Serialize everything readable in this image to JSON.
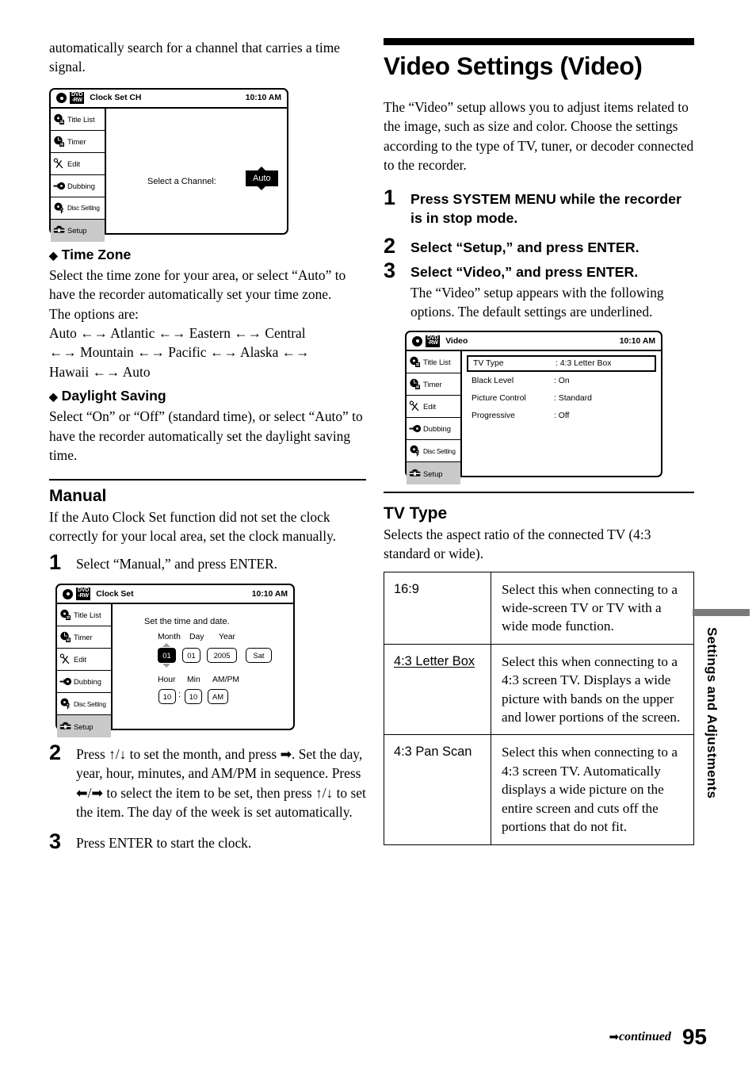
{
  "page_number": "95",
  "footer": {
    "continued": "continued",
    "arrow_icon": "right-arrow-icon"
  },
  "side_tab": {
    "label": "Settings and Adjustments"
  },
  "left_column": {
    "intro_continued": "automatically search for a channel that carries a time signal.",
    "screen_clock_set_ch": {
      "title": "Clock Set CH",
      "clock": "10:10 AM",
      "disc_label_top": "DVD",
      "disc_label_bottom": "-RW",
      "menu": [
        {
          "label": "Title List",
          "icon": "disc-list-icon",
          "selected": false
        },
        {
          "label": "Timer",
          "icon": "clock-timer-icon",
          "selected": false
        },
        {
          "label": "Edit",
          "icon": "scissors-icon",
          "selected": false
        },
        {
          "label": "Dubbing",
          "icon": "arrow-disc-icon",
          "selected": false
        },
        {
          "label": "Disc Setting",
          "icon": "disc-key-icon",
          "selected": false
        },
        {
          "label": "Setup",
          "icon": "toolbox-icon",
          "selected": true
        }
      ],
      "prompt": "Select a Channel:",
      "value": "Auto"
    },
    "time_zone": {
      "heading": "Time Zone",
      "text_1": "Select the time zone for your area, or select “Auto” to have the recorder automatically set your time zone.",
      "text_2": "The options are:",
      "options_line_1": "Auto ←→ Atlantic ←→ Eastern ←→ Central",
      "options_line_2": "←→ Mountain ←→ Pacific ←→ Alaska ←→",
      "options_line_3": "Hawaii ←→ Auto"
    },
    "daylight_saving": {
      "heading": "Daylight Saving",
      "text": "Select “On” or “Off” (standard time), or select “Auto” to have the recorder automatically set the daylight saving time."
    },
    "manual": {
      "heading": "Manual",
      "text": "If the Auto Clock Set function did not set the clock correctly for your local area, set the clock manually.",
      "steps": [
        {
          "num": "1",
          "text": "Select “Manual,” and press ENTER."
        },
        {
          "num": "2",
          "text": "Press ↑/↓ to set the month, and press ➡. Set the day, year, hour, minutes, and AM/PM in sequence. Press ⬅/➡ to select the item to be set, then press ↑/↓ to set the item. The day of the week is set automatically."
        },
        {
          "num": "3",
          "text": "Press ENTER to start the clock."
        }
      ]
    },
    "screen_clock_set": {
      "title": "Clock Set",
      "clock": "10:10 AM",
      "disc_label_top": "DVD",
      "disc_label_bottom": "-RW",
      "menu": [
        {
          "label": "Title List",
          "icon": "disc-list-icon",
          "selected": false
        },
        {
          "label": "Timer",
          "icon": "clock-timer-icon",
          "selected": false
        },
        {
          "label": "Edit",
          "icon": "scissors-icon",
          "selected": false
        },
        {
          "label": "Dubbing",
          "icon": "arrow-disc-icon",
          "selected": false
        },
        {
          "label": "Disc Setting",
          "icon": "disc-key-icon",
          "selected": false
        },
        {
          "label": "Setup",
          "icon": "toolbox-icon",
          "selected": true
        }
      ],
      "instruction": "Set the time and date.",
      "labels": {
        "month": "Month",
        "day": "Day",
        "year": "Year",
        "hour": "Hour",
        "min": "Min",
        "ampm": "AM/PM"
      },
      "values": {
        "month": "01",
        "day": "01",
        "year": "2005",
        "weekday": "Sat",
        "hour": "10",
        "min": "10",
        "ampm": "AM",
        "separator": ":"
      }
    }
  },
  "right_column": {
    "title": "Video Settings (Video)",
    "intro": "The “Video” setup allows you to adjust items related to the image, such as size and color. Choose the settings according to the type of TV, tuner, or decoder connected to the recorder.",
    "steps": [
      {
        "num": "1",
        "text": "Press SYSTEM MENU while the recorder is in stop mode."
      },
      {
        "num": "2",
        "text": "Select “Setup,” and press ENTER."
      },
      {
        "num": "3",
        "text": "Select “Video,” and press ENTER.",
        "note": "The “Video” setup appears with the following options. The default settings are underlined."
      }
    ],
    "screen_video": {
      "title": "Video",
      "clock": "10:10 AM",
      "disc_label_top": "DVD",
      "disc_label_bottom": "-RW",
      "menu": [
        {
          "label": "Title List",
          "icon": "disc-list-icon",
          "selected": false
        },
        {
          "label": "Timer",
          "icon": "clock-timer-icon",
          "selected": false
        },
        {
          "label": "Edit",
          "icon": "scissors-icon",
          "selected": false
        },
        {
          "label": "Dubbing",
          "icon": "arrow-disc-icon",
          "selected": false
        },
        {
          "label": "Disc Setting",
          "icon": "disc-key-icon",
          "selected": false
        },
        {
          "label": "Setup",
          "icon": "toolbox-icon",
          "selected": true
        }
      ],
      "rows": [
        {
          "key": "TV Type",
          "value": ": 4:3 Letter Box",
          "selected": true
        },
        {
          "key": "Black Level",
          "value": ": On",
          "selected": false
        },
        {
          "key": "Picture Control",
          "value": ": Standard",
          "selected": false
        },
        {
          "key": "Progressive",
          "value": ": Off",
          "selected": false
        }
      ]
    },
    "tv_type": {
      "heading": "TV Type",
      "description": "Selects the aspect ratio of the connected TV (4:3 standard or wide).",
      "rows": [
        {
          "option": "16:9",
          "option_underlined": false,
          "description": "Select this when connecting to a wide-screen TV or TV with a wide mode function."
        },
        {
          "option": "4:3 Letter Box",
          "option_underlined": true,
          "description": "Select this when connecting to a 4:3 screen TV. Displays a wide picture with bands on the upper and lower portions of the screen."
        },
        {
          "option": "4:3 Pan Scan",
          "option_underlined": false,
          "description": "Select this when connecting to a 4:3 screen TV. Automatically displays a wide picture on the entire screen and cuts off the portions that do not fit."
        }
      ]
    }
  }
}
